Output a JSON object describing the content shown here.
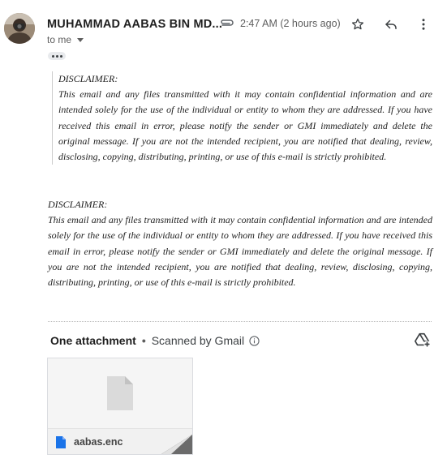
{
  "header": {
    "sender_name": "MUHAMMAD AABAS BIN MD...",
    "time": "2:47 AM (2 hours ago)",
    "recipient": "to me",
    "icons": [
      "attachment-clip-icon",
      "star-icon",
      "reply-icon",
      "more-vert-icon",
      "chevron-down-icon"
    ]
  },
  "quoted": {
    "heading": "DISCLAIMER:",
    "body": "This email and any files transmitted with it may contain confidential information and are intended solely for the use of the individual or entity to whom they are addressed. If you have received this email in error, please notify the sender or GMI immediately and delete the original message. If you are not the intended recipient, you are notified that dealing, review, disclosing, copying, distributing, printing, or use of this e-mail is strictly prohibited."
  },
  "disclaimer": {
    "heading": "DISCLAIMER:",
    "body": "This email and any files transmitted with it may contain confidential information and are intended solely for the use of the individual or entity to whom they are addressed. If you have received this email in error, please notify the sender or GMI immediately and delete the original message. If you are not the intended recipient, you are notified that dealing, review, disclosing, copying, distributing, printing, or use of this e-mail is strictly prohibited."
  },
  "attachments": {
    "count_label": "One attachment",
    "bullet": "•",
    "scanned_label": "Scanned by Gmail",
    "files": [
      {
        "name": "aabas.enc",
        "icon": "document-icon"
      }
    ]
  },
  "colors": {
    "file_icon": "#1a73e8",
    "corner": "#6b6b6b"
  }
}
